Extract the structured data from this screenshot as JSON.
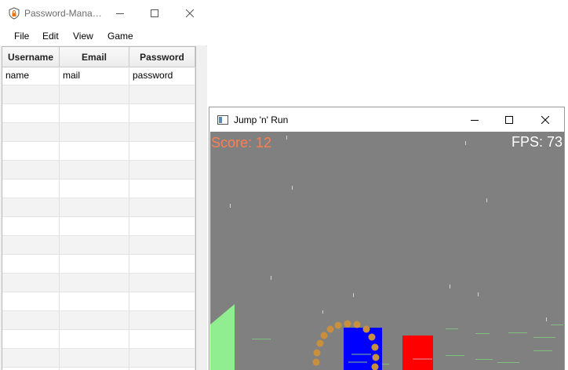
{
  "password_manager": {
    "title": "Password-Mana…",
    "menu": [
      "File",
      "Edit",
      "View",
      "Game"
    ],
    "table": {
      "columns": [
        "Username",
        "Email",
        "Password"
      ],
      "rows": [
        [
          "name",
          "mail",
          "password"
        ],
        [
          "",
          "",
          ""
        ],
        [
          "",
          "",
          ""
        ],
        [
          "",
          "",
          ""
        ],
        [
          "",
          "",
          ""
        ],
        [
          "",
          "",
          ""
        ],
        [
          "",
          "",
          ""
        ],
        [
          "",
          "",
          ""
        ],
        [
          "",
          "",
          ""
        ],
        [
          "",
          "",
          ""
        ],
        [
          "",
          "",
          ""
        ],
        [
          "",
          "",
          ""
        ],
        [
          "",
          "",
          ""
        ],
        [
          "",
          "",
          ""
        ],
        [
          "",
          "",
          ""
        ],
        [
          "",
          "",
          ""
        ],
        [
          "",
          "",
          ""
        ]
      ]
    }
  },
  "game": {
    "title": "Jump 'n' Run",
    "score_text": "Score: 12",
    "fps_text": "FPS: 73"
  },
  "colors": {
    "game_background": "#808080",
    "score": "#ff7f50",
    "player": "#0000ff",
    "enemy": "#ff0000",
    "ramp": "#90ee90",
    "jump_trail": "#c8903c"
  }
}
